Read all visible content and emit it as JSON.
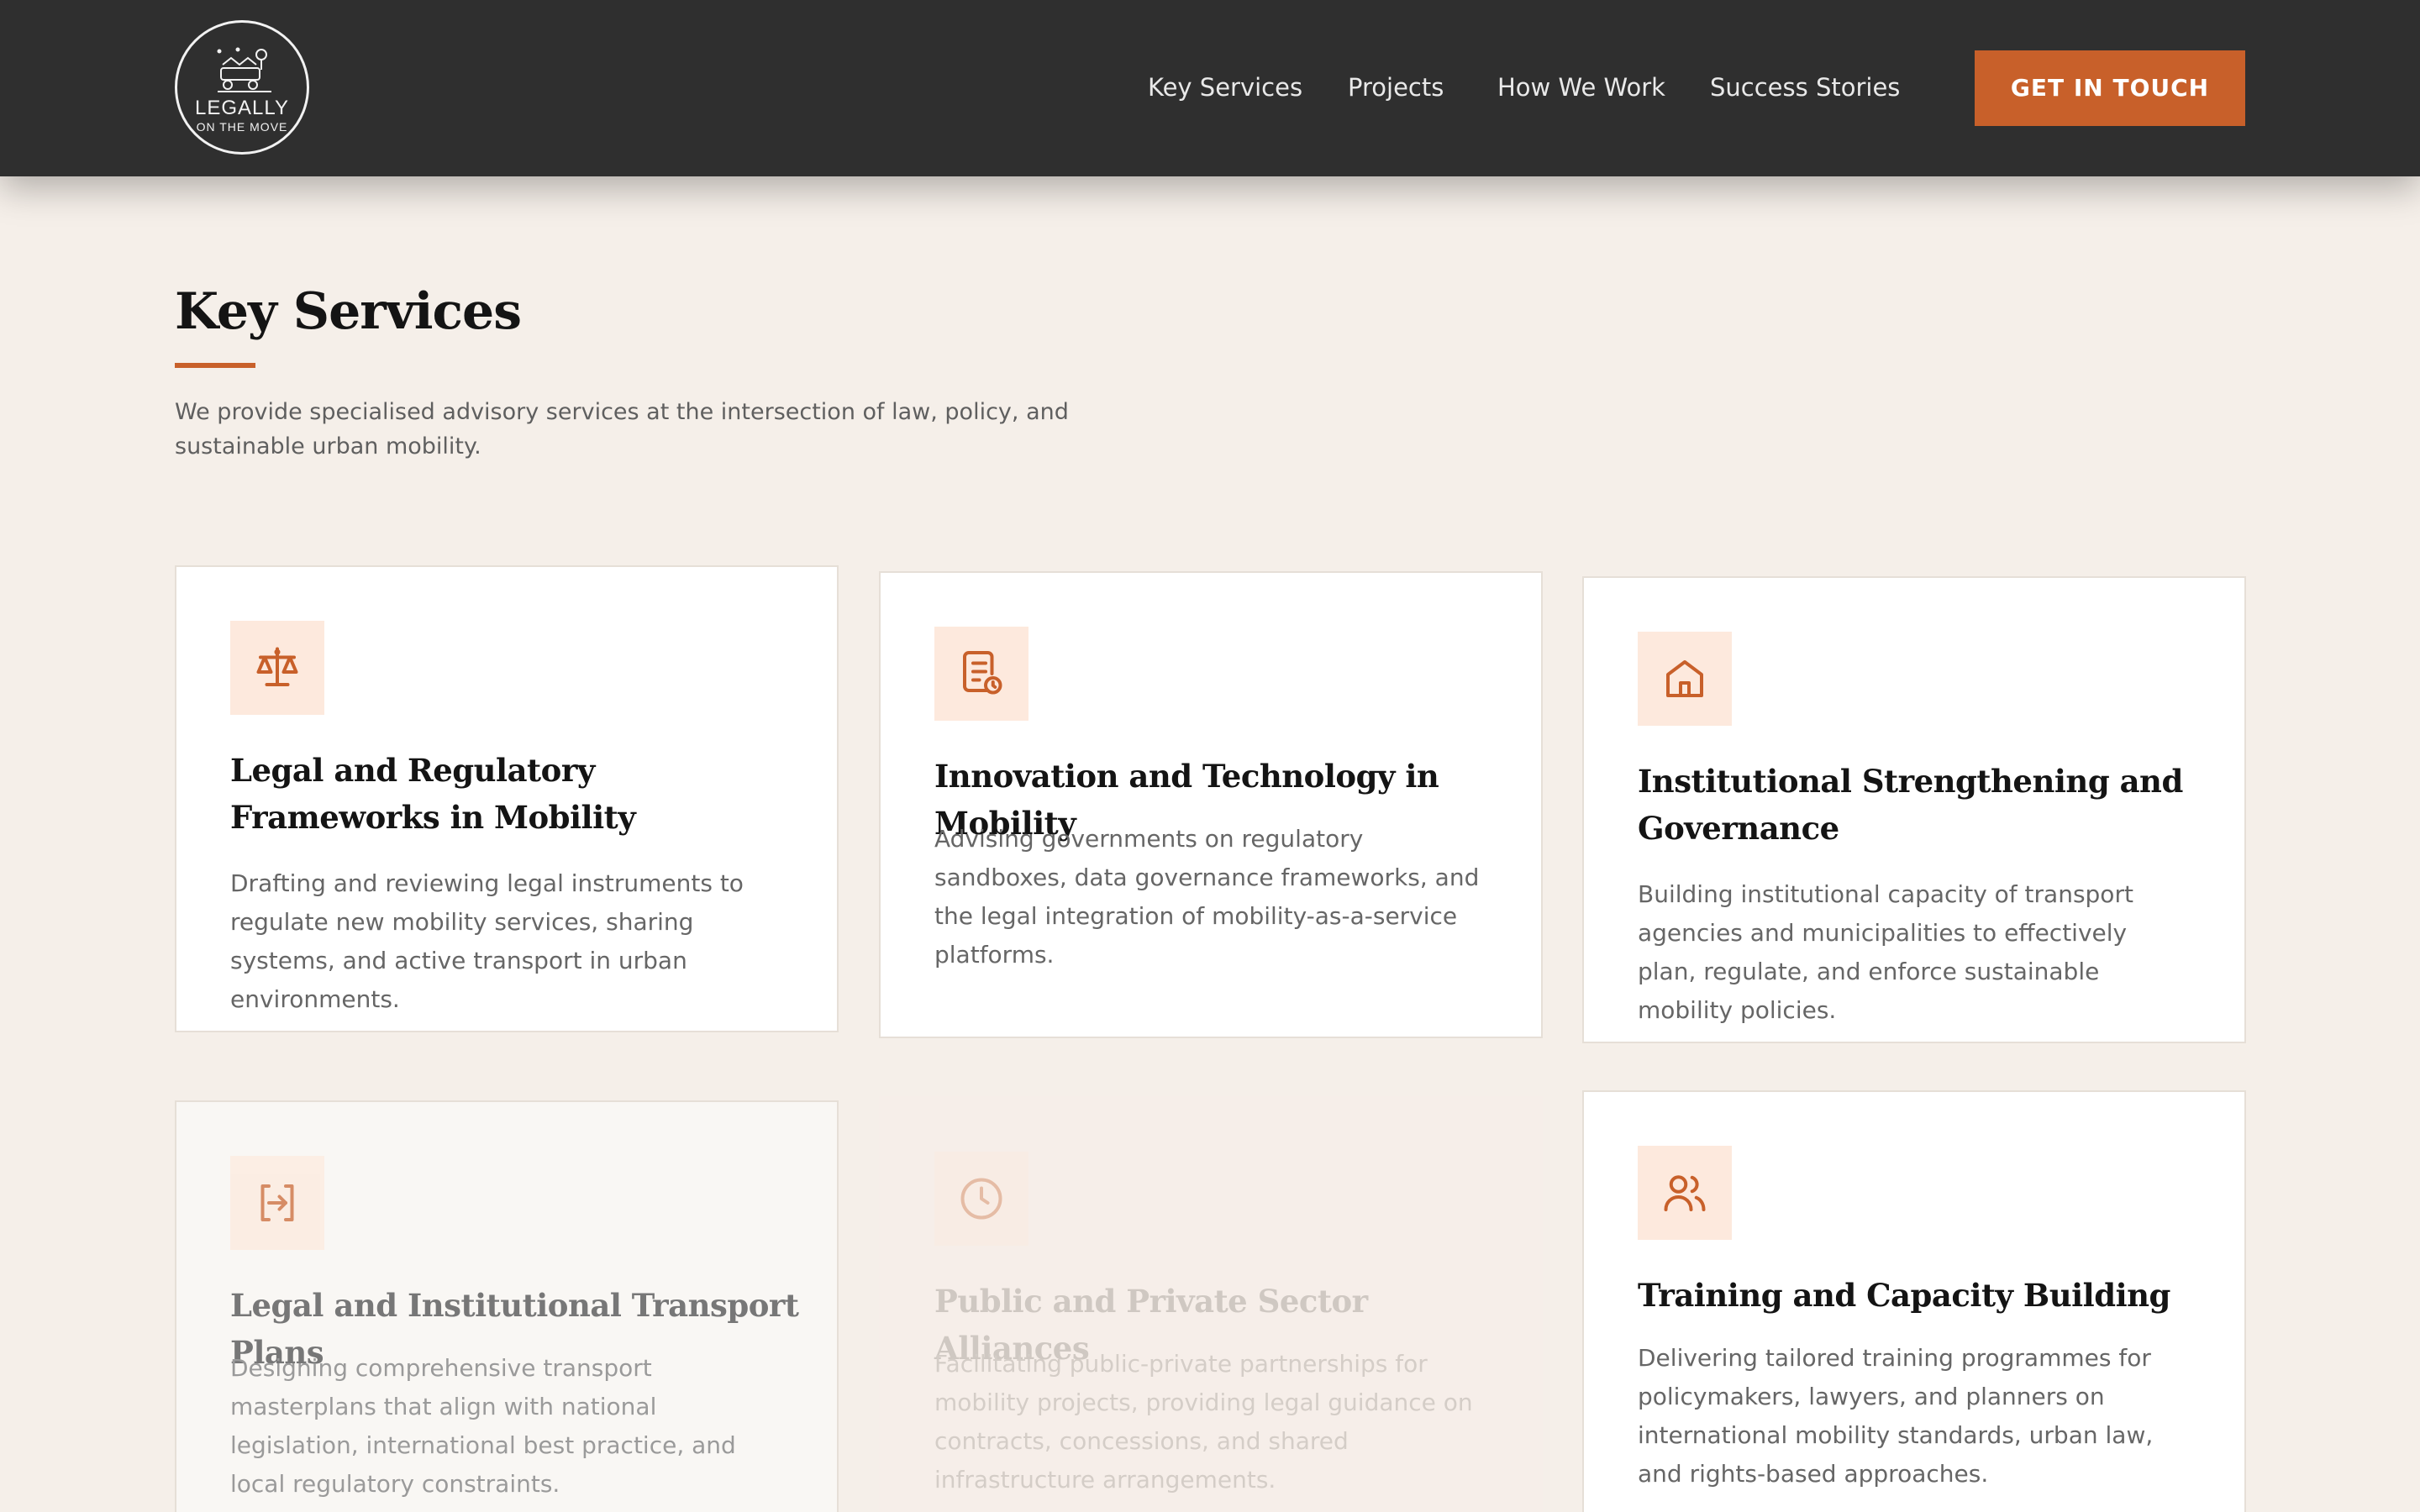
{
  "brand": {
    "name": "LEGALLY",
    "tagline": "ON THE MOVE"
  },
  "nav": {
    "items": [
      {
        "label": "Key Services"
      },
      {
        "label": "Projects"
      },
      {
        "label": "How We Work"
      },
      {
        "label": "Success Stories"
      }
    ],
    "cta_label": "GET IN TOUCH"
  },
  "section": {
    "title": "Key Services",
    "description": "We provide specialised advisory services at the intersection of law, policy, and sustainable urban mobility."
  },
  "services": [
    {
      "icon": "scales-icon",
      "title": "Legal and Regulatory Frameworks in Mobility",
      "description": "Drafting and reviewing legal instruments to regulate new mobility services, sharing systems, and active transport in urban environments."
    },
    {
      "icon": "document-clock-icon",
      "title": "Innovation and Technology in Mobility",
      "description": "Advising governments on regulatory sandboxes, data governance frameworks, and the legal integration of mobility-as-a-service platforms."
    },
    {
      "icon": "building-icon",
      "title": "Institutional Strengthening and Governance",
      "description": "Building institutional capacity of transport agencies and municipalities to effectively plan, regulate, and enforce sustainable mobility policies."
    },
    {
      "icon": "arrow-in-box-icon",
      "title": "Legal and Institutional Transport Plans",
      "description": "Designing comprehensive transport masterplans that align with national legislation, international best practice, and local regulatory constraints."
    },
    {
      "icon": "clock-icon",
      "title": "Public and Private Sector Alliances",
      "description": "Facilitating public-private partnerships for mobility projects, providing legal guidance on contracts, concessions, and shared infrastructure arrangements."
    },
    {
      "icon": "people-icon",
      "title": "Training and Capacity Building",
      "description": "Delivering tailored training programmes for policymakers, lawyers, and planners on international mobility standards, urban law, and rights-based approaches."
    }
  ],
  "colors": {
    "accent": "#c8602a",
    "header_bg": "#2f2f2f",
    "page_bg": "#f5efe9",
    "icon_bg": "#fde9dd"
  }
}
